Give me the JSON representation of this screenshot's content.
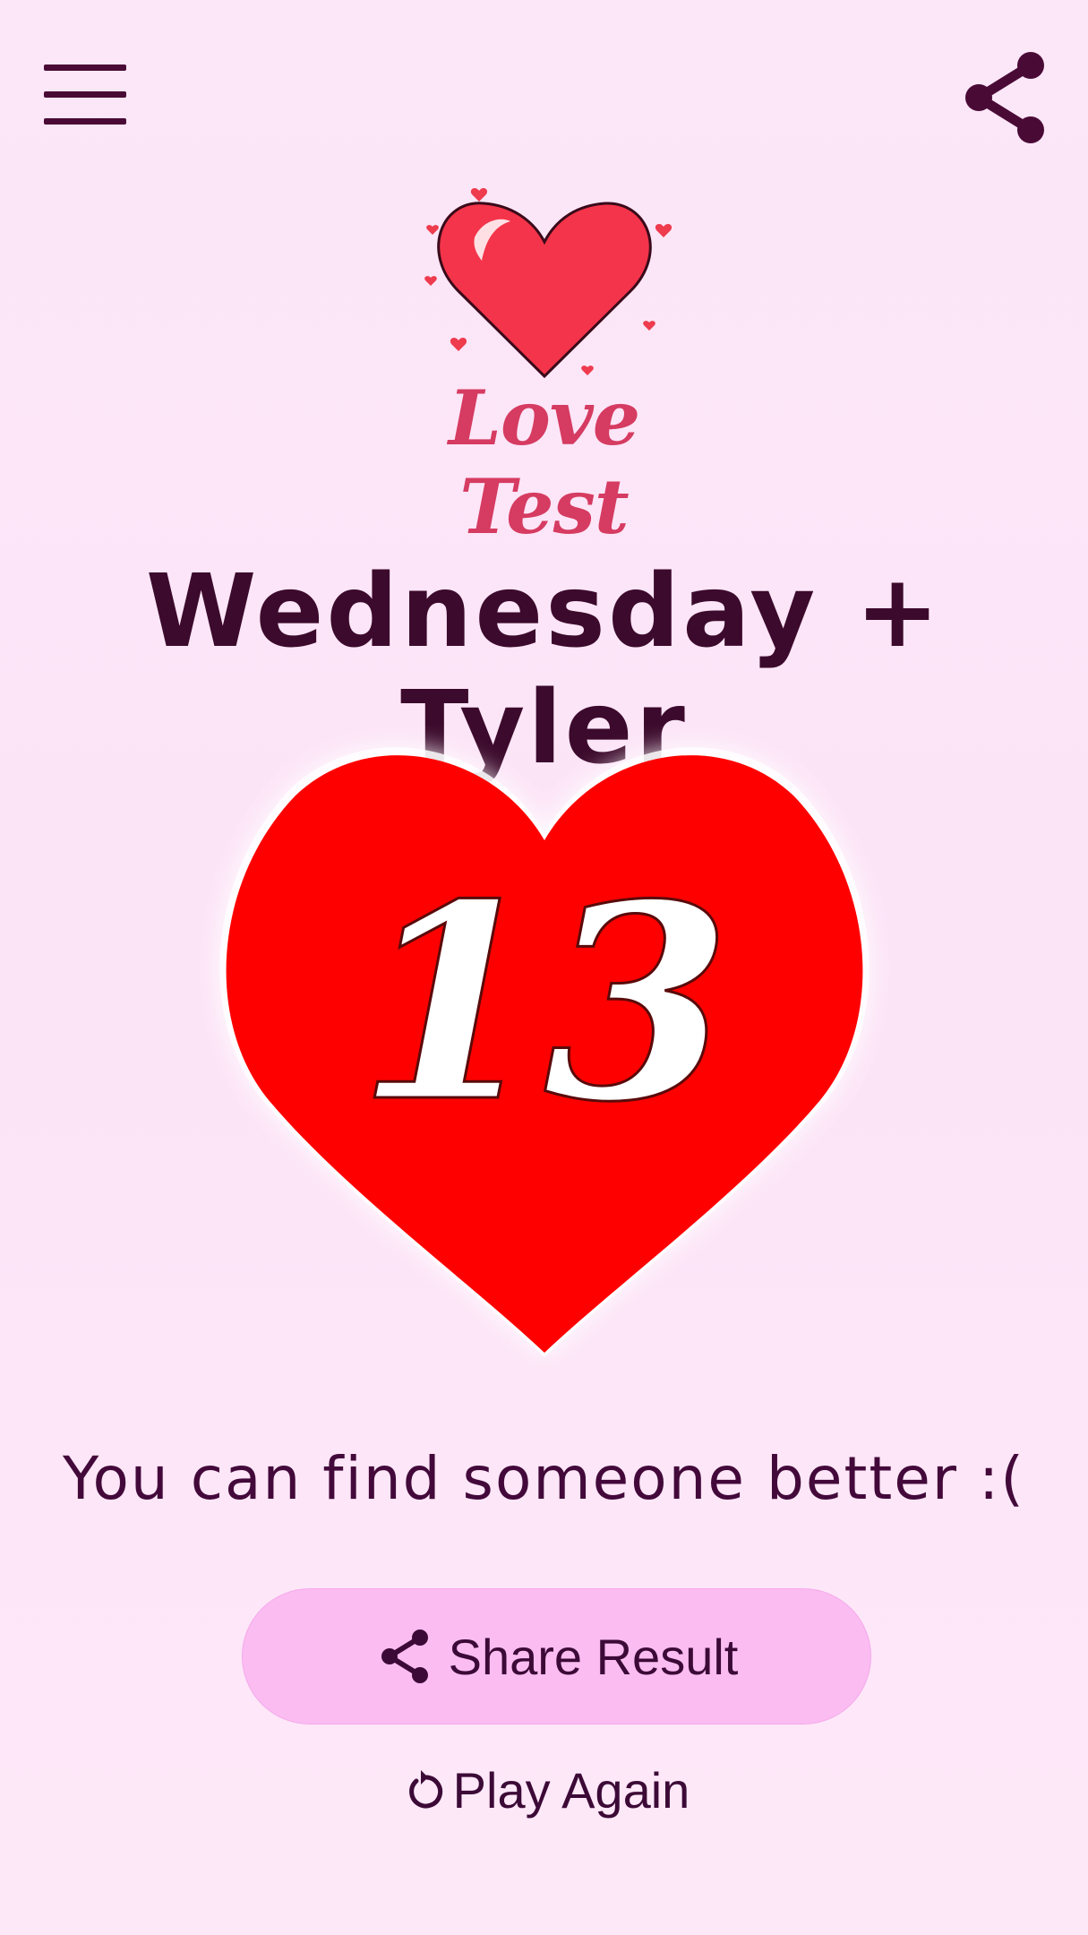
{
  "header": {
    "menu_icon": "hamburger-menu-icon",
    "share_icon": "share-icon"
  },
  "logo": {
    "text": "Love Test",
    "icon": "heart-icon"
  },
  "result": {
    "names": "Wednesday + Tyler",
    "score": "13",
    "message": "You can find someone better :("
  },
  "actions": {
    "share_label": "Share Result",
    "play_again_label": "Play Again"
  },
  "colors": {
    "background": "#fce4f7",
    "heart": "#ff0000",
    "dark_text": "#3c0a2c",
    "button_bg": "#fbbcf2"
  }
}
